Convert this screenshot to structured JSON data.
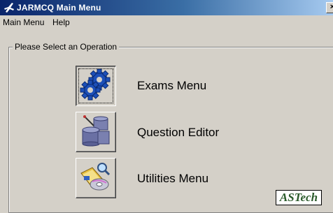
{
  "window": {
    "title": "JARMCQ Main Menu",
    "close_symbol": "×"
  },
  "menu": {
    "items": [
      "Main Menu",
      "Help"
    ]
  },
  "group": {
    "legend": "Please Select an Operation"
  },
  "operations": [
    {
      "label": "Exams Menu",
      "icon": "gears-icon"
    },
    {
      "label": "Question Editor",
      "icon": "database-edit-icon"
    },
    {
      "label": "Utilities Menu",
      "icon": "utilities-icon"
    }
  ],
  "logo": {
    "text": "ASTech"
  }
}
